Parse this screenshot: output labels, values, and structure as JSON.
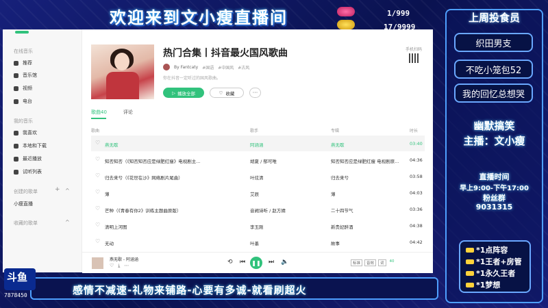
{
  "stream": {
    "title": "欢迎来到文小瘦直播间",
    "counter_top": "1/999",
    "counter_bottom": "17/9999",
    "banner": "感情不减速-礼物来铺路-心要有多诚-就看刷超火",
    "logo_text": "斗鱼",
    "room_id": "7878450"
  },
  "sidebar": {
    "section_online": "在线音乐",
    "online_items": [
      "推荐",
      "音乐馆",
      "视频",
      "电台"
    ],
    "section_mine": "我的音乐",
    "mine_items": [
      "我喜欢",
      "本地和下载",
      "最近播放",
      "试听列表"
    ],
    "section_created": "创建的歌单",
    "created_items": [
      "小瘦直播"
    ],
    "section_fav": "收藏的歌单",
    "plus": "+",
    "chevron": "^"
  },
  "playlist": {
    "title": "热门合集丨抖音最火国风歌曲",
    "author": "By Fantcaty",
    "tags": [
      "#国语",
      "#中国风",
      "#古风"
    ],
    "desc": "你在抖音一定听过的国风歌曲。",
    "play_all": "播放全部",
    "favorite": "收藏",
    "more": "···",
    "qr_label": "手机扫码",
    "tab_songs": "歌曲40",
    "tab_comments": "评论"
  },
  "table": {
    "headers": {
      "song": "歌曲",
      "artist": "歌手",
      "album": "专辑",
      "duration": "时长"
    },
    "rows": [
      {
        "song": "燕无歇",
        "artist": "阿涵涵",
        "album": "燕无歇",
        "duration": "03:40",
        "active": true
      },
      {
        "song": "知否知否（《知否知否应是绿肥红瘦》电视剧主...",
        "artist": "胡夏 / 郁可唯",
        "album": "知否知否应是绿肥红瘦 电视剧原...",
        "duration": "04:36",
        "active": false
      },
      {
        "song": "归去来兮（《花世在沙》网络剧片尾曲）",
        "artist": "叶炫清",
        "album": "归去来兮",
        "duration": "03:58",
        "active": false
      },
      {
        "song": "薄",
        "artist": "艾辰",
        "album": "薄",
        "duration": "04:03",
        "active": false
      },
      {
        "song": "芒种（《青春有你2》训练主题曲原版）",
        "artist": "音阙诗听 / 赵方婧",
        "album": "二十四节气",
        "duration": "03:36",
        "active": false
      },
      {
        "song": "清明上河图",
        "artist": "李玉刚",
        "album": "新贵妃醉酒",
        "duration": "04:38",
        "active": false
      },
      {
        "song": "无动",
        "artist": "叶墨",
        "album": "故事",
        "duration": "04:42",
        "active": false
      }
    ]
  },
  "player": {
    "song": "燕无歇 - 阿涵涵",
    "count": "40",
    "quality": "标准",
    "effect": "音效",
    "lyric": "词"
  },
  "right_panel": {
    "title": "上周投食员",
    "fans": [
      "织田男支",
      "不吃小笼包52",
      "我的回忆总想哭"
    ],
    "slogan1": "幽默搞笑",
    "slogan2": "主播：文小瘦",
    "time_title": "直播时间",
    "time_value": "早上9:00-下午17:00",
    "fan_group_title": "粉丝群",
    "fan_group_id": "9031315",
    "gifts": [
      "*1点阵容",
      "*1王者+房管",
      "*1永久王者",
      "*1梦想"
    ]
  },
  "colors": {
    "accent": "#31c27c",
    "panel_border": "#4ea0ff"
  }
}
